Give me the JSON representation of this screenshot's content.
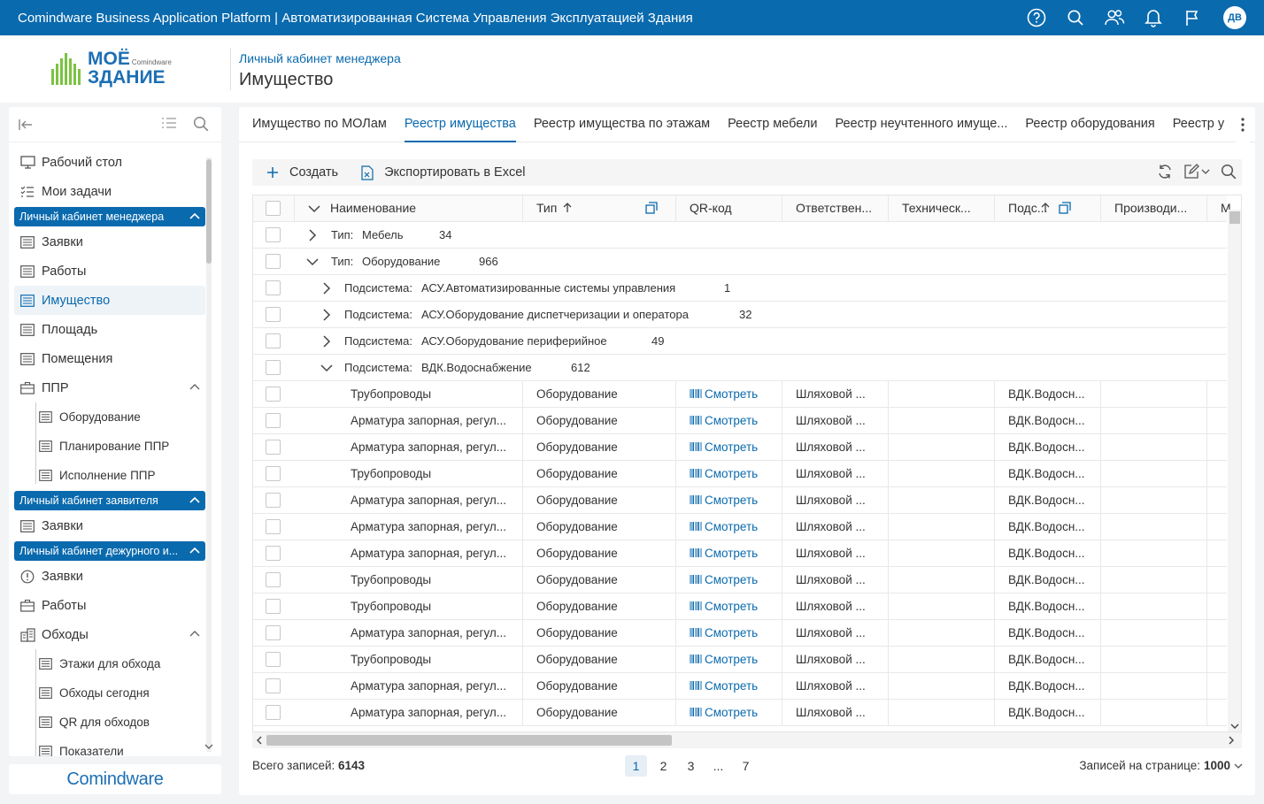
{
  "topbar": {
    "title": "Comindware Business Application Platform  |  Автоматизированная Система Управления Эксплуатацией Здания",
    "avatar": "ДВ"
  },
  "logo": {
    "line1": "МОЁ",
    "line2": "ЗДАНИЕ",
    "brand_small": "Comindware"
  },
  "header": {
    "breadcrumb": "Личный кабинет менеджера",
    "title": "Имущество"
  },
  "sidebar": {
    "items": [
      {
        "label": "Рабочий стол",
        "icon": "desktop-icon"
      },
      {
        "label": "Мои задачи",
        "icon": "tasks-icon"
      }
    ],
    "group1": {
      "label": "Личный кабинет менеджера",
      "items": [
        "Заявки",
        "Работы",
        "Имущество",
        "Площадь",
        "Помещения",
        "ППР"
      ],
      "ppr_sub": [
        "Оборудование",
        "Планирование ППР",
        "Исполнение ППР"
      ]
    },
    "group2": {
      "label": "Личный кабинет заявителя",
      "items": [
        "Заявки"
      ]
    },
    "group3": {
      "label": "Личный кабинет дежурного и...",
      "items": [
        "Заявки",
        "Работы",
        "Обходы"
      ],
      "obhody_sub": [
        "Этажи для обхода",
        "Обходы сегодня",
        "QR для обходов",
        "Показатели"
      ]
    }
  },
  "footer_logo": "Comindware",
  "tabs": [
    "Имущество по МОЛам",
    "Реестр имущества",
    "Реестр имущества по этажам",
    "Реестр мебели",
    "Реестр неучтенного имуще...",
    "Реестр оборудования",
    "Реестр у"
  ],
  "toolbar": {
    "create": "Создать",
    "export": "Экспортировать в Excel"
  },
  "grid": {
    "headers": [
      "Наименование",
      "Тип",
      "QR-код",
      "Ответствен...",
      "Техническ...",
      "Подс...",
      "Производи...",
      "М"
    ],
    "groups": [
      {
        "prefix": "Тип:",
        "value": "Мебель",
        "count": "34"
      },
      {
        "prefix": "Тип:",
        "value": "Оборудование",
        "count": "966"
      },
      {
        "prefix": "Подсистема:",
        "value": "АСУ.Автоматизированные системы управления",
        "count": "1"
      },
      {
        "prefix": "Подсистема:",
        "value": "АСУ.Оборудование диспетчеризации и оператора",
        "count": "32"
      },
      {
        "prefix": "Подсистема:",
        "value": "АСУ.Оборудование периферийное",
        "count": "49"
      },
      {
        "prefix": "Подсистема:",
        "value": "ВДК.Водоснабжение",
        "count": "612"
      }
    ],
    "rows": [
      {
        "name": "Трубопроводы",
        "type": "Оборудование",
        "qr": "Смотреть",
        "resp": "Шляховой ...",
        "sub": "ВДК.Водосн..."
      },
      {
        "name": "Арматура запорная, регул...",
        "type": "Оборудование",
        "qr": "Смотреть",
        "resp": "Шляховой ...",
        "sub": "ВДК.Водосн..."
      },
      {
        "name": "Арматура запорная, регул...",
        "type": "Оборудование",
        "qr": "Смотреть",
        "resp": "Шляховой ...",
        "sub": "ВДК.Водосн..."
      },
      {
        "name": "Трубопроводы",
        "type": "Оборудование",
        "qr": "Смотреть",
        "resp": "Шляховой ...",
        "sub": "ВДК.Водосн..."
      },
      {
        "name": "Арматура запорная, регул...",
        "type": "Оборудование",
        "qr": "Смотреть",
        "resp": "Шляховой ...",
        "sub": "ВДК.Водосн..."
      },
      {
        "name": "Арматура запорная, регул...",
        "type": "Оборудование",
        "qr": "Смотреть",
        "resp": "Шляховой ...",
        "sub": "ВДК.Водосн..."
      },
      {
        "name": "Арматура запорная, регул...",
        "type": "Оборудование",
        "qr": "Смотреть",
        "resp": "Шляховой ...",
        "sub": "ВДК.Водосн..."
      },
      {
        "name": "Трубопроводы",
        "type": "Оборудование",
        "qr": "Смотреть",
        "resp": "Шляховой ...",
        "sub": "ВДК.Водосн..."
      },
      {
        "name": "Трубопроводы",
        "type": "Оборудование",
        "qr": "Смотреть",
        "resp": "Шляховой ...",
        "sub": "ВДК.Водосн..."
      },
      {
        "name": "Арматура запорная, регул...",
        "type": "Оборудование",
        "qr": "Смотреть",
        "resp": "Шляховой ...",
        "sub": "ВДК.Водосн..."
      },
      {
        "name": "Трубопроводы",
        "type": "Оборудование",
        "qr": "Смотреть",
        "resp": "Шляховой ...",
        "sub": "ВДК.Водосн..."
      },
      {
        "name": "Арматура запорная, регул...",
        "type": "Оборудование",
        "qr": "Смотреть",
        "resp": "Шляховой ...",
        "sub": "ВДК.Водосн..."
      },
      {
        "name": "Арматура запорная, регул...",
        "type": "Оборудование",
        "qr": "Смотреть",
        "resp": "Шляховой ...",
        "sub": "ВДК.Водосн..."
      }
    ]
  },
  "pager": {
    "total_label": "Всего записей:",
    "total": "6143",
    "pages": [
      "1",
      "2",
      "3",
      "...",
      "7"
    ],
    "per_page_label": "Записей на странице:",
    "per_page": "1000"
  },
  "colors": {
    "accent": "#0a6aae",
    "logo_green": "#7bc242"
  }
}
